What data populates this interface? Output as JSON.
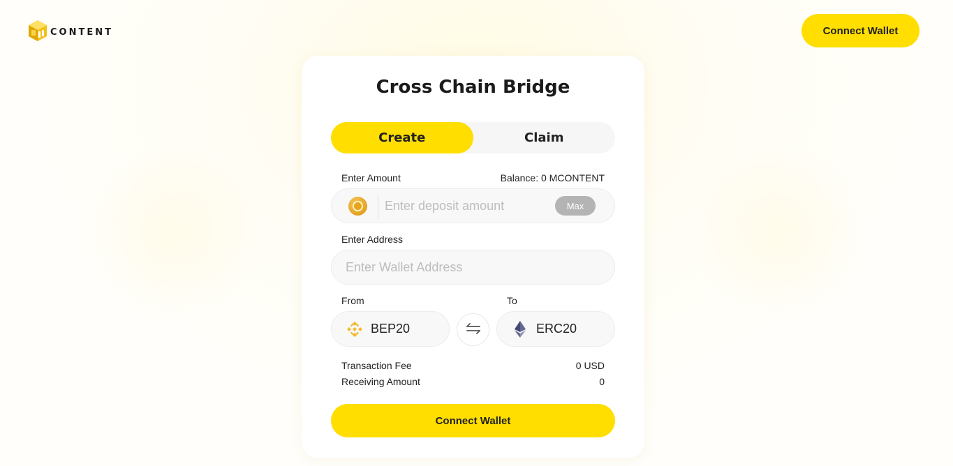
{
  "header": {
    "logo_text": "CONTENT",
    "connect_wallet_label": "Connect Wallet"
  },
  "card": {
    "title": "Cross Chain Bridge",
    "tabs": [
      {
        "label": "Create",
        "active": true
      },
      {
        "label": "Claim",
        "active": false
      }
    ],
    "amount": {
      "label": "Enter Amount",
      "balance": "Balance: 0 MCONTENT",
      "placeholder": "Enter deposit amount",
      "value": "",
      "max_label": "Max",
      "token_icon": "mcontent-coin-icon"
    },
    "address": {
      "label": "Enter Address",
      "placeholder": "Enter Wallet Address",
      "value": ""
    },
    "from": {
      "label": "From",
      "chain": "BEP20",
      "icon": "binance-icon"
    },
    "to": {
      "label": "To",
      "chain": "ERC20",
      "icon": "ethereum-icon"
    },
    "swap_icon": "swap-arrows-icon",
    "fee": {
      "label": "Transaction Fee",
      "value": "0 USD"
    },
    "receiving": {
      "label": "Receiving Amount",
      "value": "0"
    },
    "submit_label": "Connect Wallet"
  },
  "colors": {
    "accent": "#ffde00",
    "binance": "#f3ba2f",
    "ethereum": "#3c3c3d"
  }
}
